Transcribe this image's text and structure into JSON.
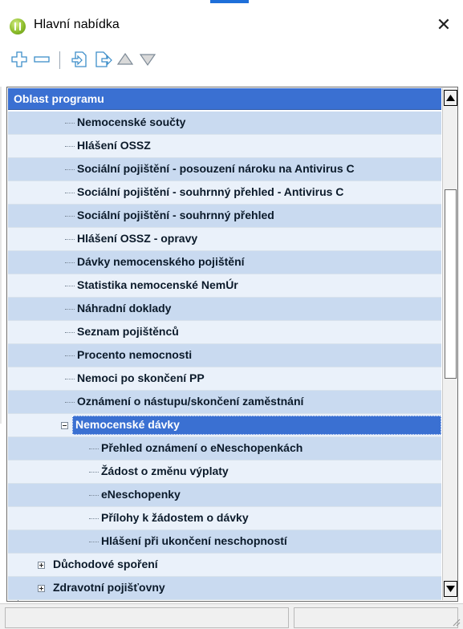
{
  "window": {
    "title": "Hlavní nabídka",
    "close_glyph": "✕",
    "icon": "app-logo-icon"
  },
  "toolbar": {
    "items": [
      {
        "name": "expand-all-button",
        "icon": "plus-icon"
      },
      {
        "name": "collapse-all-button",
        "icon": "minus-icon"
      },
      {
        "name": "page-in-button",
        "icon": "page-arrow-in-icon"
      },
      {
        "name": "page-out-button",
        "icon": "page-arrow-out-icon"
      },
      {
        "name": "move-up-button",
        "icon": "triangle-up-icon"
      },
      {
        "name": "move-down-button",
        "icon": "triangle-down-icon"
      }
    ]
  },
  "tree": {
    "header": "Oblast programu",
    "rows": [
      {
        "label": "Nemocenské součty"
      },
      {
        "label": "Hlášení OSSZ"
      },
      {
        "label": "Sociální pojištění - posouzení nároku na Antivirus C"
      },
      {
        "label": "Sociální pojištění - souhrnný přehled - Antivirus C"
      },
      {
        "label": "Sociální pojištění - souhrnný přehled"
      },
      {
        "label": "Hlášení OSSZ - opravy"
      },
      {
        "label": "Dávky nemocenského pojištění"
      },
      {
        "label": "Statistika nemocenské NemÚr"
      },
      {
        "label": "Náhradní doklady"
      },
      {
        "label": "Seznam pojištěnců"
      },
      {
        "label": "Procento nemocnosti"
      },
      {
        "label": "Nemoci po skončení PP"
      },
      {
        "label": "Oznámení o nástupu/skončení zaměstnání"
      },
      {
        "label": "Nemocenské dávky",
        "selected": true,
        "expanded": true
      },
      {
        "label": "Přehled oznámení o eNeschopenkách"
      },
      {
        "label": "Žádost o změnu výplaty"
      },
      {
        "label": "eNeschopenky"
      },
      {
        "label": "Přílohy k žádostem o dávky"
      },
      {
        "label": "Hlášení při ukončení neschopností"
      },
      {
        "label": "Důchodové spoření",
        "expandable": true
      },
      {
        "label": "Zdravotní pojišťovny",
        "expandable": true
      }
    ]
  },
  "colors": {
    "header_bg": "#3a70d2",
    "selected_bg": "#3a70d2",
    "row_alt": "#c9daf0",
    "row_norm": "#eaf1fa"
  },
  "status": {
    "panel1": "",
    "panel2": ""
  }
}
